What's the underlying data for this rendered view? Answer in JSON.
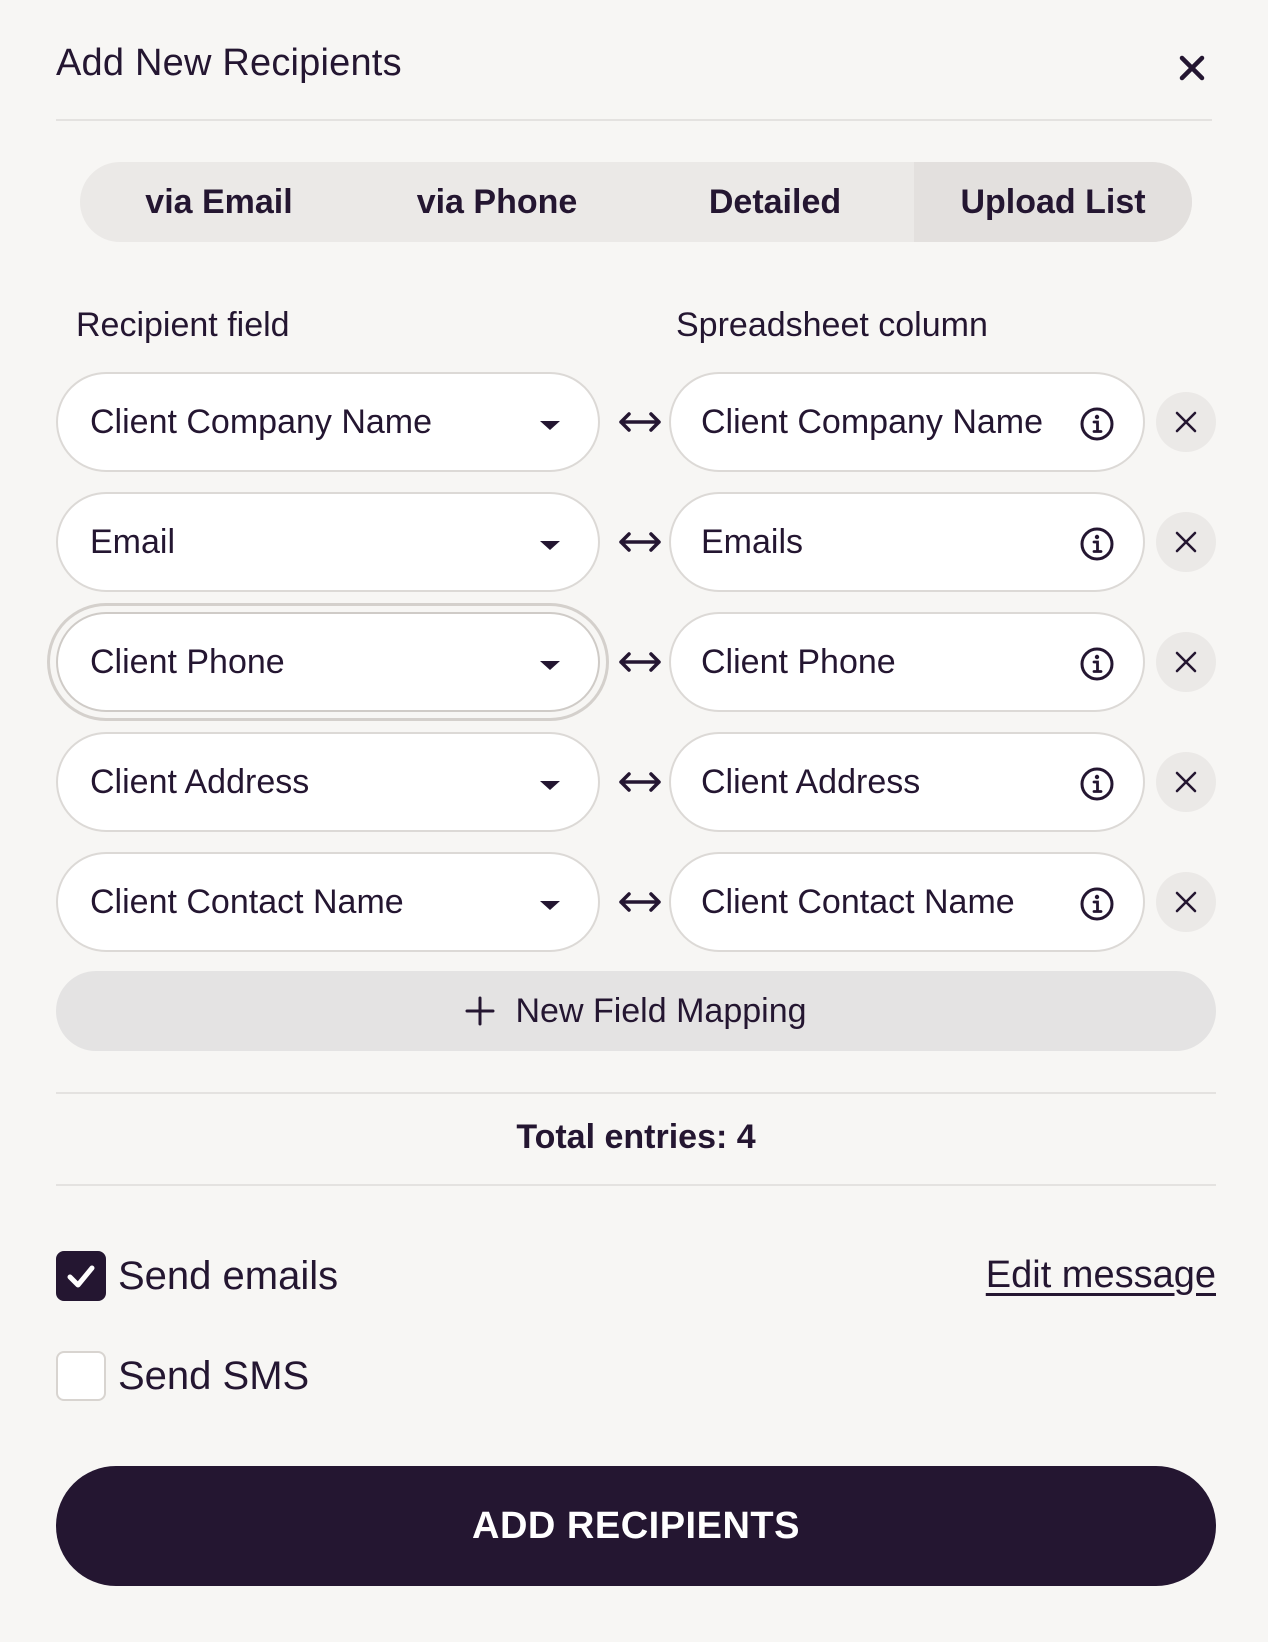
{
  "dialog": {
    "title": "Add New Recipients",
    "close_icon": "close-icon"
  },
  "tabs": [
    {
      "label": "via Email",
      "active": false
    },
    {
      "label": "via Phone",
      "active": false
    },
    {
      "label": "Detailed",
      "active": false
    },
    {
      "label": "Upload List",
      "active": true
    }
  ],
  "columns": {
    "left": "Recipient field",
    "right": "Spreadsheet column"
  },
  "mappings": [
    {
      "field": "Client Company Name",
      "column": "Client Company Name"
    },
    {
      "field": "Email",
      "column": "Emails"
    },
    {
      "field": "Client Phone",
      "column": "Client Phone"
    },
    {
      "field": "Client Address",
      "column": "Client Address"
    },
    {
      "field": "Client Contact Name",
      "column": "Client Contact Name"
    }
  ],
  "new_mapping_label": "New Field Mapping",
  "total_entries": "Total entries: 4",
  "options": {
    "send_emails": {
      "label": "Send emails",
      "checked": true
    },
    "send_sms": {
      "label": "Send SMS",
      "checked": false
    },
    "edit_message": "Edit message"
  },
  "submit_label": "ADD RECIPIENTS",
  "colors": {
    "primary": "#241631",
    "background": "#f7f6f4",
    "tab_bg": "#ebe9e7"
  }
}
